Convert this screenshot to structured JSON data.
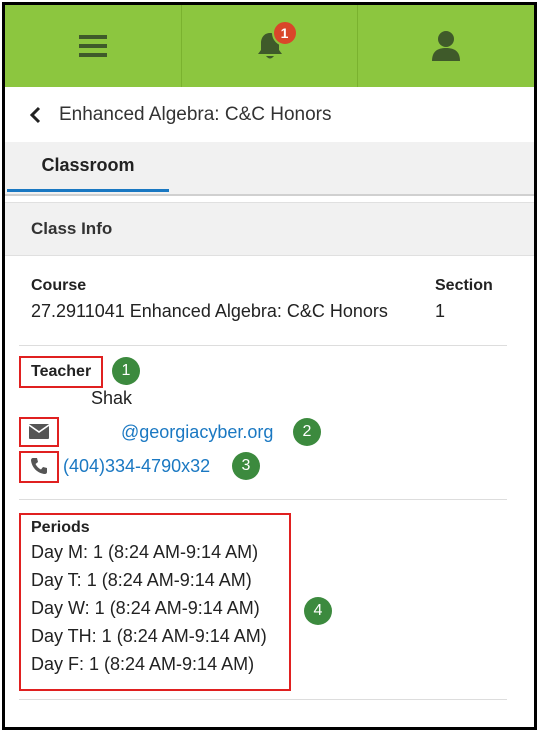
{
  "topbar": {
    "menu_icon": "hamburger-menu-icon",
    "notifications_icon": "bell-icon",
    "notification_count": "1",
    "profile_icon": "user-icon",
    "bar_color": "#8cc63f"
  },
  "header": {
    "back_icon": "chevron-left-icon",
    "title": "Enhanced Algebra: C&C Honors"
  },
  "tabs": [
    {
      "label": "Classroom",
      "active": true
    }
  ],
  "section": {
    "title": "Class Info"
  },
  "course": {
    "label": "Course",
    "value": "27.2911041 Enhanced Algebra: C&C Honors"
  },
  "section_info": {
    "label": "Section",
    "value": "1"
  },
  "teacher": {
    "label": "Teacher",
    "name": "Shak",
    "email": "@georgiacyber.org",
    "phone": "(404)334-4790x32",
    "email_icon": "envelope-icon",
    "phone_icon": "phone-icon"
  },
  "periods": {
    "label": "Periods",
    "items": [
      "Day M: 1 (8:24 AM-9:14 AM)",
      "Day T: 1 (8:24 AM-9:14 AM)",
      "Day W: 1 (8:24 AM-9:14 AM)",
      "Day TH: 1 (8:24 AM-9:14 AM)",
      "Day F: 1 (8:24 AM-9:14 AM)"
    ]
  },
  "annotations": [
    "1",
    "2",
    "3",
    "4"
  ],
  "colors": {
    "accent": "#1a78c2",
    "badge": "#d9462a",
    "annotation_box": "#e02020",
    "annotation_marker": "#3c8a3e"
  }
}
